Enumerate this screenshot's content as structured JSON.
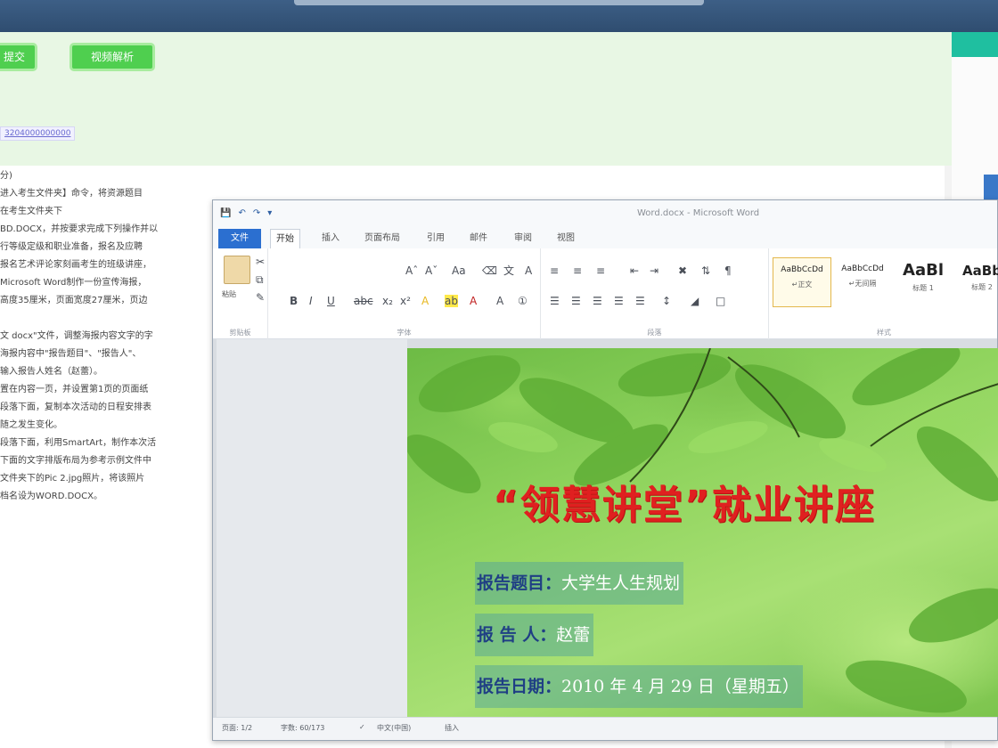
{
  "background_app": {
    "buttons": [
      "提交",
      "视频解析"
    ],
    "link_text": "3204000000000",
    "task_lines": [
      "分)",
      "进入考生文件夹】命令，将资源题目",
      "在考生文件夹下",
      "BD.DOCX，并按要求完成下列操作并以",
      "行等级定级和职业准备，报名及应聘",
      "报名艺术评论家刻画考生的班级讲座，",
      "Microsoft Word制作一份宣传海报，",
      "高度35厘米，页面宽度27厘米，页边",
      "",
      "文 docx\"文件，调整海报内容文字的字",
      "海报内容中\"报告题目\"、\"报告人\"、",
      "输入报告人姓名（赵蕾）。",
      "置在内容一页，并设置第1页的页面纸",
      "段落下面，复制本次活动的日程安排表",
      "随之发生变化。",
      "段落下面，利用SmartArt，制作本次活",
      "下面的文字排版布局为参考示例文件中",
      "文件夹下的Pic 2.jpg照片，将该照片",
      "档名设为WORD.DOCX。"
    ]
  },
  "word": {
    "window_title": "Word.docx - Microsoft Word",
    "qat_icons": [
      "save-icon",
      "undo-icon",
      "redo-icon",
      "customize-icon"
    ],
    "tabs": [
      "文件",
      "开始",
      "插入",
      "页面布局",
      "引用",
      "邮件",
      "审阅",
      "视图"
    ],
    "active_tab": "开始",
    "ribbon": {
      "paste_label": "粘贴",
      "group_labels": [
        "剪贴板",
        "字体",
        "段落",
        "样式"
      ],
      "styles": [
        {
          "sample": "AaBbCcDd",
          "name": "↵正文"
        },
        {
          "sample": "AaBbCcDd",
          "name": "↵无间隔"
        },
        {
          "sample": "AaBl",
          "name": "标题 1"
        },
        {
          "sample": "AaBb",
          "name": "标题 2"
        }
      ]
    },
    "page": {
      "headline": "“领慧讲堂”就业讲座",
      "rows": [
        {
          "label": "报告题目：",
          "value": "大学生人生规划"
        },
        {
          "label": "报 告 人：",
          "value": "赵蕾"
        },
        {
          "label": "报告日期：",
          "value": "2010 年 4 月 29 日（星期五）"
        }
      ],
      "colors": {
        "headline": "#e02020",
        "label": "#1f3f84",
        "value": "#ffffff",
        "leaf": "#6cbf3e"
      }
    },
    "statusbar": {
      "page": "页面: 1/2",
      "words": "字数: 60/173",
      "lang": "中文(中国)",
      "mode": "插入"
    }
  }
}
